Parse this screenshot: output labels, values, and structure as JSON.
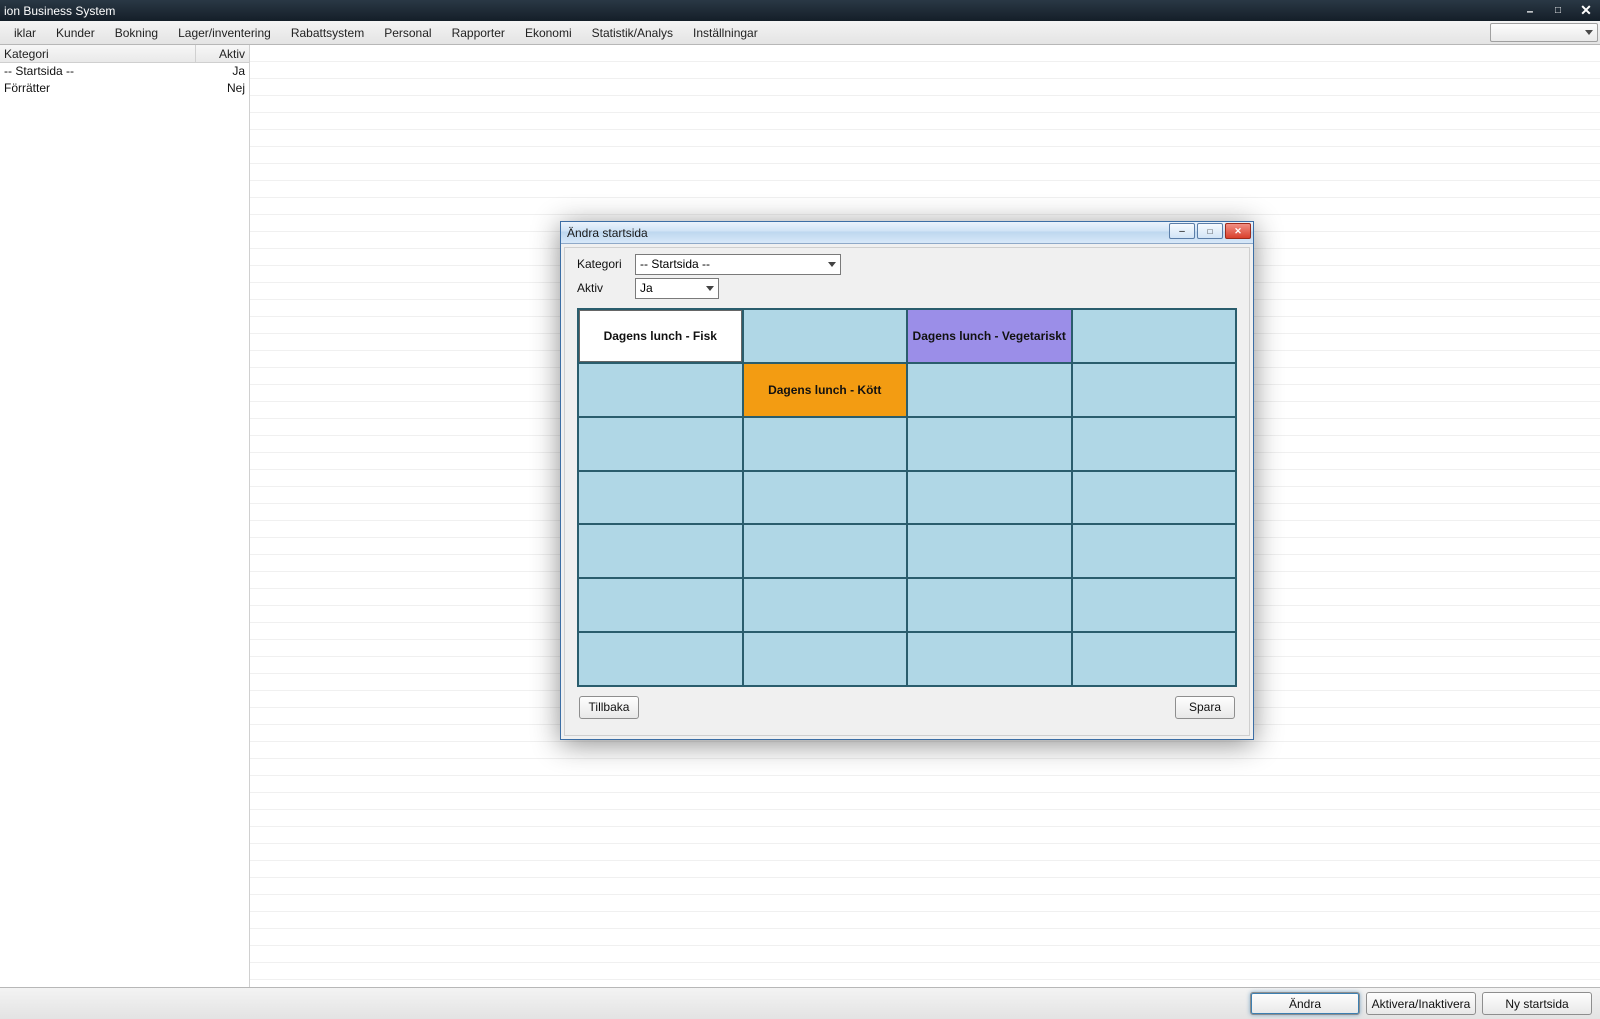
{
  "window": {
    "title": "ion Business System"
  },
  "menu": {
    "items": [
      "iklar",
      "Kunder",
      "Bokning",
      "Lager/inventering",
      "Rabattsystem",
      "Personal",
      "Rapporter",
      "Ekonomi",
      "Statistik/Analys",
      "Inställningar"
    ]
  },
  "list": {
    "header": {
      "col1": "Kategori",
      "col2": "Aktiv"
    },
    "rows": [
      {
        "name": "-- Startsida --",
        "active": "Ja"
      },
      {
        "name": "Förrätter",
        "active": "Nej"
      }
    ]
  },
  "bottom": {
    "edit": "Ändra",
    "toggle": "Aktivera/Inaktivera",
    "new": "Ny startsida"
  },
  "dialog": {
    "title": "Ändra startsida",
    "field_category_label": "Kategori",
    "field_category_value": "-- Startsida --",
    "field_active_label": "Aktiv",
    "field_active_value": "Ja",
    "grid": {
      "rows": 7,
      "cols": 4,
      "cells": [
        {
          "r": 0,
          "c": 0,
          "text": "Dagens lunch - Fisk",
          "style": "white"
        },
        {
          "r": 0,
          "c": 2,
          "text": "Dagens lunch - Vegetariskt",
          "style": "purple"
        },
        {
          "r": 1,
          "c": 1,
          "text": "Dagens lunch - Kött",
          "style": "orange"
        }
      ]
    },
    "back": "Tillbaka",
    "save": "Spara"
  }
}
